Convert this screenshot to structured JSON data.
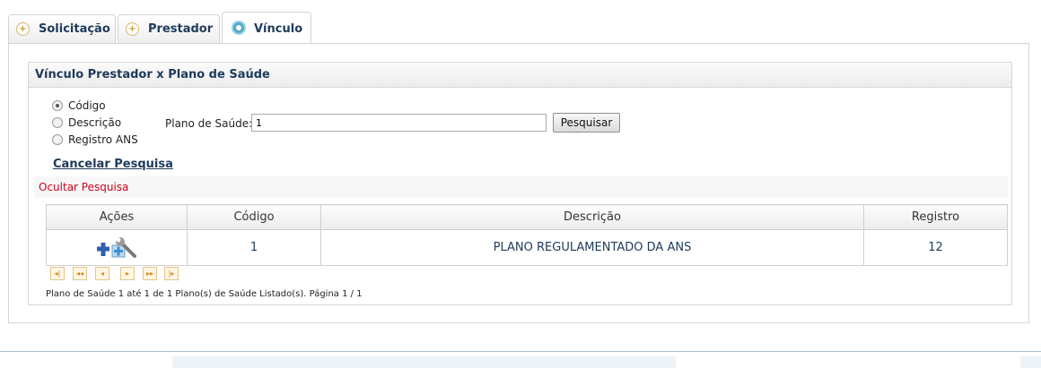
{
  "tabs": [
    {
      "label": "Solicitação",
      "icon": "plus-circle-icon"
    },
    {
      "label": "Prestador",
      "icon": "plus-circle-icon"
    },
    {
      "label": "Vínculo",
      "icon": "radio-active-icon"
    }
  ],
  "panel": {
    "title": "Vínculo Prestador x Plano de Saúde"
  },
  "search": {
    "options": [
      "Código",
      "Descrição",
      "Registro ANS"
    ],
    "selected": "Código",
    "label": "Plano de Saúde:",
    "value": "1",
    "button_label": "Pesquisar"
  },
  "cancel_label": "Cancelar Pesquisa",
  "hide_label": "Ocultar Pesquisa",
  "table": {
    "headers": [
      "Ações",
      "Código",
      "Descrição",
      "Registro"
    ],
    "rows": [
      {
        "codigo": "1",
        "descricao": "PLANO REGULAMENTADO DA ANS",
        "registro": "12"
      }
    ]
  },
  "pager": {
    "buttons": [
      "first-icon",
      "prev-fast-icon",
      "prev-icon",
      "next-icon",
      "next-fast-icon",
      "last-icon"
    ],
    "info": "Plano de Saúde 1 até 1 de 1 Plano(s) de Saúde Listado(s). Página 1 / 1"
  },
  "colors": {
    "accent_text": "#1e3a5a",
    "hide_link": "#d0021b",
    "pager_icon": "#d58b1b"
  }
}
